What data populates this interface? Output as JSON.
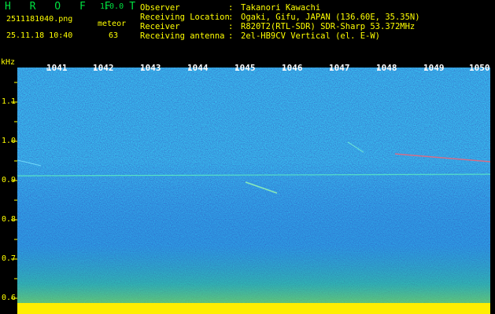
{
  "app": {
    "brand": "H R O F F T",
    "version": "1.0.0"
  },
  "file": {
    "filename": "2511181040.png",
    "datetime": "25.11.18 10:40",
    "meteor_label": "meteor",
    "meteor_count": "63"
  },
  "info": [
    {
      "key": "Observer",
      "value": "Takanori Kawachi"
    },
    {
      "key": "Receiving Location",
      "value": "Ogaki, Gifu, JAPAN (136.60E, 35.35N)"
    },
    {
      "key": "Receiver",
      "value": "R820T2(RTL-SDR) SDR-Sharp 53.372MHz"
    },
    {
      "key": "Receiving antenna",
      "value": "2el-HB9CV Vertical (el. E-W)"
    }
  ],
  "y_axis": {
    "unit": "kHz",
    "ticks": [
      "1.1",
      "1.0",
      "0.9",
      "0.8",
      "0.7",
      "0.6"
    ]
  },
  "time_axis": {
    "labels": [
      "1041",
      "1042",
      "1043",
      "1044",
      "1045",
      "1046",
      "1047",
      "1048",
      "1049",
      "1050"
    ]
  },
  "colors": {
    "header_text": "#ffff00",
    "brand": "#00e040",
    "background": "#000000"
  }
}
